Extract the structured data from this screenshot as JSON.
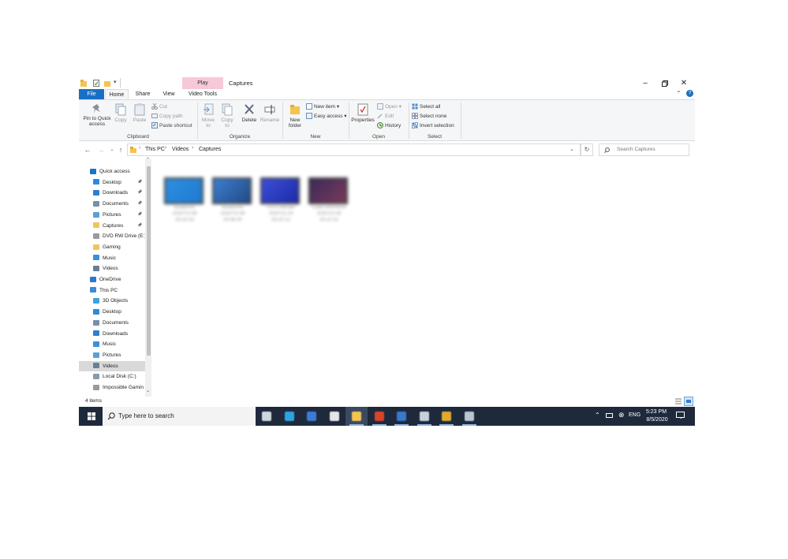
{
  "window": {
    "title": "Captures",
    "context_tab": "Play",
    "controls": [
      "minimize",
      "maximize",
      "close"
    ]
  },
  "tabs": [
    "File",
    "Home",
    "Share",
    "View",
    "Video Tools"
  ],
  "ribbon": {
    "clipboard": {
      "pin": "Pin to Quick access",
      "copy": "Copy",
      "paste": "Paste",
      "cut": "Cut",
      "copy_path": "Copy path",
      "paste_shortcut": "Paste shortcut",
      "label": "Clipboard"
    },
    "organize": {
      "move_to": "Move to",
      "copy_to": "Copy to",
      "delete": "Delete",
      "rename": "Rename",
      "label": "Organize"
    },
    "new": {
      "new_folder": "New folder",
      "new_item": "New item",
      "easy_access": "Easy access",
      "label": "New"
    },
    "open": {
      "properties": "Properties",
      "open": "Open",
      "edit": "Edit",
      "history": "History",
      "label": "Open"
    },
    "select": {
      "select_all": "Select all",
      "select_none": "Select none",
      "invert": "Invert selection",
      "label": "Select"
    }
  },
  "address": {
    "crumbs": [
      "This PC",
      "Videos",
      "Captures"
    ],
    "search_placeholder": "Search Captures"
  },
  "sidebar": {
    "items": [
      {
        "label": "Quick access",
        "indent": 0,
        "color": "#1a73c9",
        "pinned": false
      },
      {
        "label": "Desktop",
        "indent": 1,
        "color": "#2d8ad8",
        "pinned": true
      },
      {
        "label": "Downloads",
        "indent": 1,
        "color": "#2d7fd0",
        "pinned": true
      },
      {
        "label": "Documents",
        "indent": 1,
        "color": "#7a8fa8",
        "pinned": true
      },
      {
        "label": "Pictures",
        "indent": 1,
        "color": "#5aa0d8",
        "pinned": true
      },
      {
        "label": "Captures",
        "indent": 1,
        "color": "#f2c45a",
        "pinned": true
      },
      {
        "label": "DVD RW Drive (E:)",
        "indent": 1,
        "color": "#9a9a9a",
        "pinned": false
      },
      {
        "label": "Gaming",
        "indent": 1,
        "color": "#f2c45a",
        "pinned": false
      },
      {
        "label": "Music",
        "indent": 1,
        "color": "#3b8fdc",
        "pinned": false
      },
      {
        "label": "Videos",
        "indent": 1,
        "color": "#6a7e95",
        "pinned": false
      },
      {
        "label": "OneDrive",
        "indent": 0,
        "color": "#2a78d2",
        "pinned": false
      },
      {
        "label": "This PC",
        "indent": 0,
        "color": "#3a8ad6",
        "pinned": false
      },
      {
        "label": "3D Objects",
        "indent": 1,
        "color": "#3aa4e0",
        "pinned": false
      },
      {
        "label": "Desktop",
        "indent": 1,
        "color": "#2d8ad8",
        "pinned": false
      },
      {
        "label": "Documents",
        "indent": 1,
        "color": "#7a8fa8",
        "pinned": false
      },
      {
        "label": "Downloads",
        "indent": 1,
        "color": "#2d7fd0",
        "pinned": false
      },
      {
        "label": "Music",
        "indent": 1,
        "color": "#3b8fdc",
        "pinned": false
      },
      {
        "label": "Pictures",
        "indent": 1,
        "color": "#5aa0d8",
        "pinned": false
      },
      {
        "label": "Videos",
        "indent": 1,
        "color": "#6a7e95",
        "pinned": false,
        "selected": true
      },
      {
        "label": "Local Disk (C:)",
        "indent": 1,
        "color": "#8a9aaa",
        "pinned": false
      },
      {
        "label": "Impossible Gamin",
        "indent": 1,
        "color": "#9a9a9a",
        "pinned": false
      }
    ]
  },
  "files": [
    {
      "name": "Blueprints",
      "date": "2020-01-08",
      "time": "16-20-33",
      "colors": [
        "#2f8fe0",
        "#1e7ad0"
      ]
    },
    {
      "name": "Blueprints",
      "date": "2020-01-08",
      "time": "16-48-30",
      "colors": [
        "#3d7fcf",
        "#214a86"
      ]
    },
    {
      "name": "FIFA Ultimate",
      "date": "2020-01-24",
      "time": "16-20-12",
      "colors": [
        "#3c4fd8",
        "#1c2aa8"
      ]
    },
    {
      "name": "Cube Adventure",
      "date": "2020-01-08",
      "time": "16-21-02",
      "colors": [
        "#3a2a58",
        "#7a3a5a"
      ]
    }
  ],
  "status": {
    "count": "4 items"
  },
  "taskbar": {
    "search_placeholder": "Type here to search",
    "lang": "ENG",
    "time": "5:23 PM",
    "date": "8/5/2020"
  }
}
